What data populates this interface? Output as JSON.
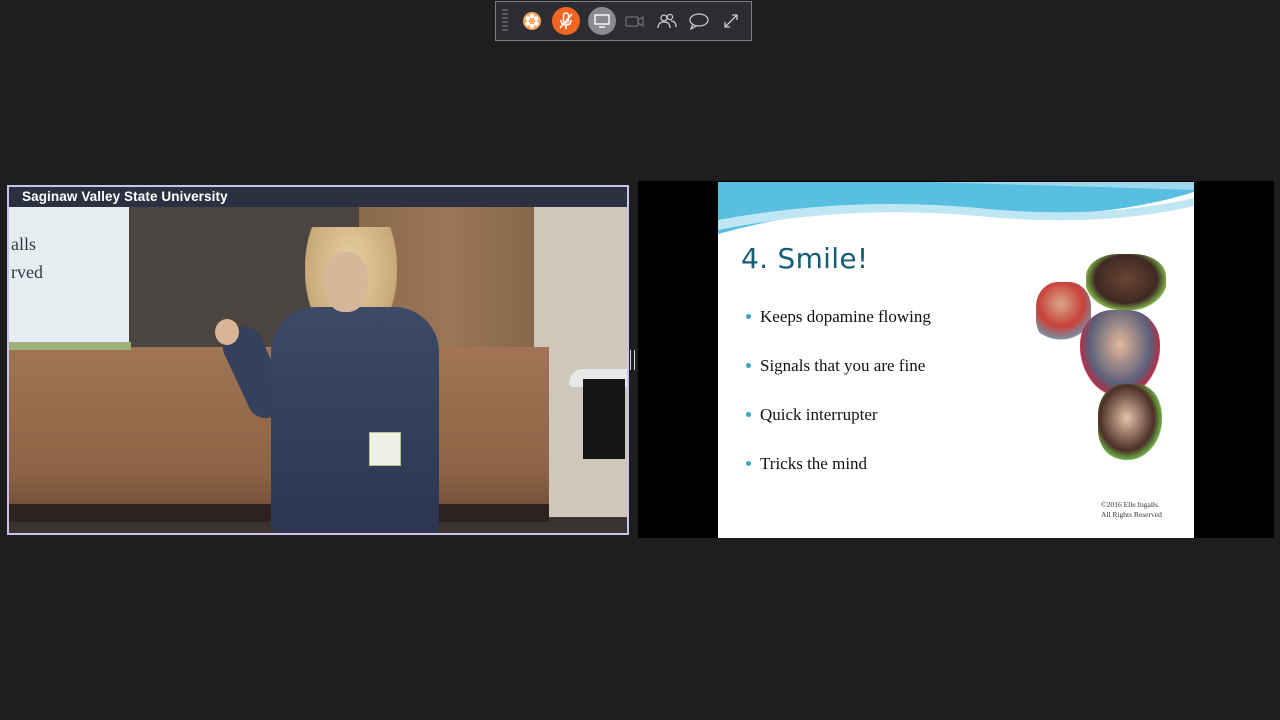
{
  "toolbar": {
    "buttons": [
      {
        "name": "apps",
        "icon": "hexagon-apps-icon"
      },
      {
        "name": "microphone",
        "icon": "microphone-icon",
        "state": "muted",
        "color": "#f26522"
      },
      {
        "name": "share-screen",
        "icon": "monitor-icon",
        "state": "active"
      },
      {
        "name": "camera",
        "icon": "video-camera-icon",
        "state": "disabled"
      },
      {
        "name": "participants",
        "icon": "people-icon"
      },
      {
        "name": "chat",
        "icon": "chat-bubble-icon"
      },
      {
        "name": "fullscreen",
        "icon": "expand-icon"
      }
    ]
  },
  "video": {
    "label": "Saginaw Valley State University",
    "screen_text_lines": [
      "alls",
      "rved"
    ]
  },
  "slide": {
    "title": "4. Smile!",
    "bullets": [
      "Keeps dopamine flowing",
      "Signals that you are fine",
      "Quick interrupter",
      "Tricks the mind"
    ],
    "copyright_line1": "©2016 Elle Ingalls",
    "copyright_line2": "All Rights Reserved"
  },
  "colors": {
    "background": "#1e1e1e",
    "toolbar": "#2c2d31",
    "mic_accent": "#f26522",
    "video_border": "#c7c2ee",
    "slide_title": "#155e7a",
    "bullet_dot": "#3aa4c4"
  }
}
